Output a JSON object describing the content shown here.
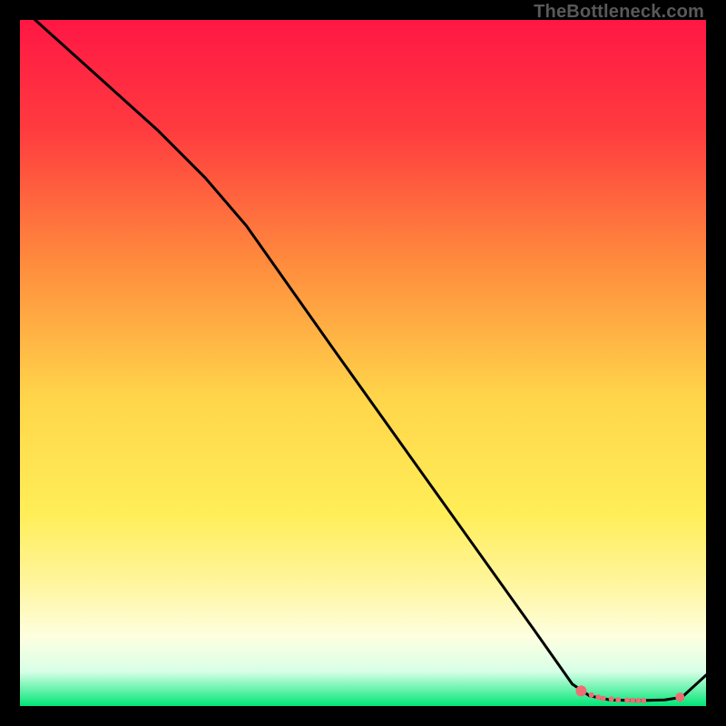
{
  "watermark": "TheBottleneck.com",
  "chart_data": {
    "type": "line",
    "title": "",
    "xlabel": "",
    "ylabel": "",
    "xlim": [
      0,
      100
    ],
    "ylim": [
      0,
      100
    ],
    "gradient_stops": [
      {
        "offset": 0,
        "color": "#ff1744"
      },
      {
        "offset": 0.16,
        "color": "#ff3b3f"
      },
      {
        "offset": 0.35,
        "color": "#ff8a3d"
      },
      {
        "offset": 0.55,
        "color": "#ffd54a"
      },
      {
        "offset": 0.72,
        "color": "#ffee58"
      },
      {
        "offset": 0.82,
        "color": "#fff59d"
      },
      {
        "offset": 0.9,
        "color": "#fdffe0"
      },
      {
        "offset": 0.95,
        "color": "#d7ffe7"
      },
      {
        "offset": 1.0,
        "color": "#00e676"
      }
    ],
    "series": [
      {
        "name": "curve",
        "color": "#000000",
        "x": [
          0,
          10,
          20,
          27,
          33,
          45,
          60,
          75,
          80.5,
          83,
          86,
          90,
          94,
          96.5,
          100
        ],
        "y": [
          102,
          93,
          84,
          77,
          70,
          53,
          32,
          11,
          3.2,
          1.5,
          0.9,
          0.8,
          0.9,
          1.3,
          4.5
        ]
      }
    ],
    "markers": [
      {
        "name": "valley-left-end",
        "x": 81.8,
        "y": 2.2,
        "r": 6,
        "color": "#ee6e73"
      },
      {
        "name": "valley-dot-1",
        "x": 83.3,
        "y": 1.6,
        "r": 3,
        "color": "#ee6e73"
      },
      {
        "name": "valley-dash-1a",
        "x": 84.3,
        "y": 1.3,
        "r": 3,
        "color": "#ee6e73"
      },
      {
        "name": "valley-dash-1b",
        "x": 85.0,
        "y": 1.1,
        "r": 3,
        "color": "#ee6e73"
      },
      {
        "name": "valley-dot-2",
        "x": 86.2,
        "y": 1.0,
        "r": 3,
        "color": "#ee6e73"
      },
      {
        "name": "valley-dot-3",
        "x": 87.2,
        "y": 0.9,
        "r": 3,
        "color": "#ee6e73"
      },
      {
        "name": "valley-dash-2a",
        "x": 88.5,
        "y": 0.85,
        "r": 3,
        "color": "#ee6e73"
      },
      {
        "name": "valley-dash-2b",
        "x": 89.3,
        "y": 0.82,
        "r": 3,
        "color": "#ee6e73"
      },
      {
        "name": "valley-dash-2c",
        "x": 90.1,
        "y": 0.8,
        "r": 3,
        "color": "#ee6e73"
      },
      {
        "name": "valley-dash-2d",
        "x": 90.9,
        "y": 0.8,
        "r": 3,
        "color": "#ee6e73"
      },
      {
        "name": "valley-right-dot",
        "x": 96.2,
        "y": 1.3,
        "r": 5,
        "color": "#ee6e73"
      }
    ]
  }
}
